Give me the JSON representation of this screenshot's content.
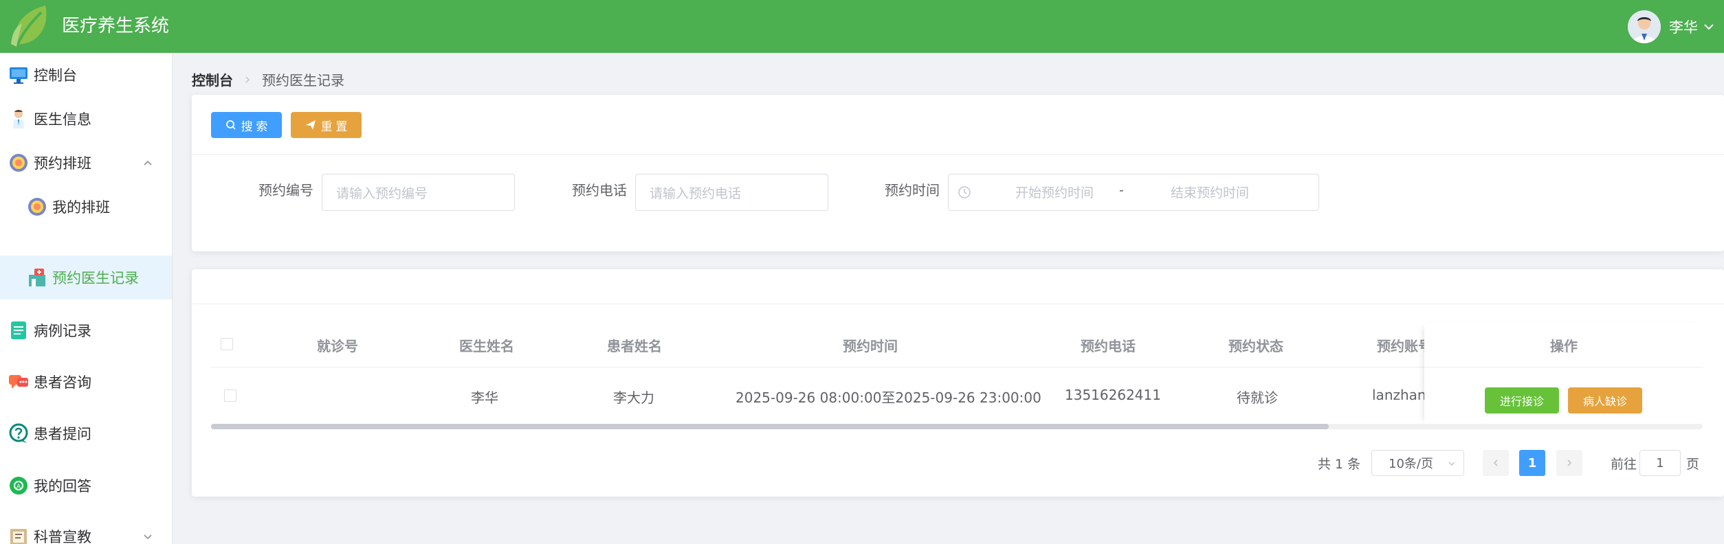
{
  "header": {
    "title": "医疗养生系统",
    "user_name": "李华"
  },
  "sidebar": {
    "items": [
      {
        "label": "控制台",
        "icon": "monitor-icon"
      },
      {
        "label": "医生信息",
        "icon": "doctor-icon"
      },
      {
        "label": "预约排班",
        "icon": "gear-flower-icon"
      },
      {
        "label": "我的排班",
        "icon": "gear-flower-icon"
      },
      {
        "label": "预约医生记录",
        "icon": "clinic-icon"
      },
      {
        "label": "病例记录",
        "icon": "document-icon"
      },
      {
        "label": "患者咨询",
        "icon": "chat-icon"
      },
      {
        "label": "患者提问",
        "icon": "question-icon"
      },
      {
        "label": "我的回答",
        "icon": "answer-icon"
      },
      {
        "label": "科普宣教",
        "icon": "book-icon"
      }
    ]
  },
  "breadcrumb": {
    "home": "控制台",
    "current": "预约医生记录"
  },
  "search": {
    "search_button": "搜 索",
    "reset_button": "重 置",
    "fields": {
      "appt_no_label": "预约编号",
      "appt_no_placeholder": "请输入预约编号",
      "phone_label": "预约电话",
      "phone_placeholder": "请输入预约电话",
      "time_label": "预约时间",
      "start_placeholder": "开始预约时间",
      "range_sep": "-",
      "end_placeholder": "结束预约时间"
    }
  },
  "table": {
    "columns": [
      "就诊号",
      "医生姓名",
      "患者姓名",
      "预约时间",
      "预约电话",
      "预约状态",
      "预约账号",
      "操作"
    ],
    "rows": [
      {
        "visit_no": "",
        "doctor": "李华",
        "patient": "李大力",
        "time": "2025-09-26 08:00:00至2025-09-26 23:00:00",
        "phone": "13516262411",
        "status": "待就诊",
        "account": "lanzhanf",
        "actions": [
          "进行接诊",
          "病人缺诊"
        ]
      }
    ]
  },
  "pagination": {
    "total": "共 1 条",
    "page_size": "10条/页",
    "current_page": "1",
    "goto_prefix": "前往",
    "goto_value": "1",
    "goto_suffix": "页"
  }
}
